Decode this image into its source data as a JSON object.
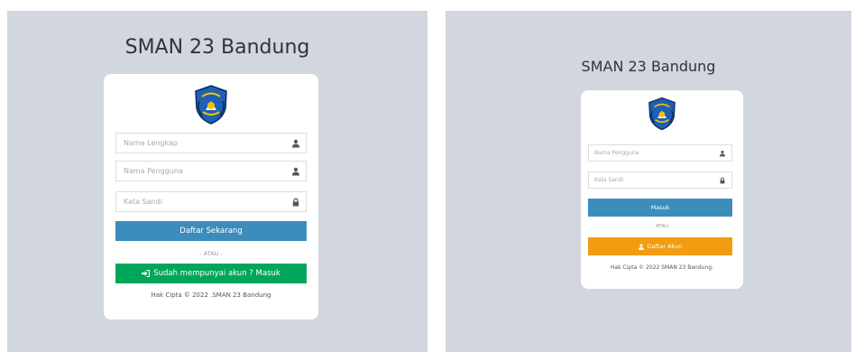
{
  "colors": {
    "background": "#d2d6de",
    "card": "#ffffff",
    "primary_blue": "#3c8dbc",
    "success_green": "#00a65a",
    "warning_orange": "#f39c12"
  },
  "register": {
    "title": "SMAN 23 Bandung",
    "logo_icon": "school-crest-icon",
    "fields": {
      "full_name_placeholder": "Nama Lengkap",
      "username_placeholder": "Nama Pengguna",
      "password_placeholder": "Kata Sandi"
    },
    "submit_label": "Daftar Sekarang",
    "separator": "- ATAU -",
    "login_link_label": "Sudah mempunyai akun ? Masuk",
    "login_link_icon": "sign-in-icon",
    "footer": "Hak Cipta © 2022 .SMAN 23 Bandung"
  },
  "login": {
    "title": "SMAN 23 Bandung",
    "logo_icon": "school-crest-icon",
    "fields": {
      "username_placeholder": "Nama Pengguna",
      "password_placeholder": "Kata Sandi"
    },
    "submit_label": "Masuk",
    "separator": "ATAU",
    "register_label": "Daftar Akun",
    "register_icon": "user-icon",
    "footer": "Hak Cipta © 2022 SMAN 23 Bandung."
  }
}
